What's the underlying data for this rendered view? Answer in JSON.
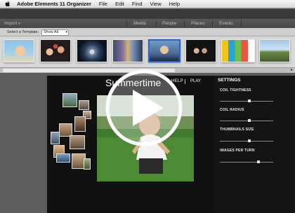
{
  "menubar": {
    "app_name": "Adobe Elements 11 Organizer",
    "items": [
      "File",
      "Edit",
      "Find",
      "View",
      "Help"
    ]
  },
  "toolbar": {
    "import_label": "Import",
    "import_arrow": "▾",
    "tabs": [
      "Media",
      "People",
      "Places",
      "Events"
    ]
  },
  "template_bar": {
    "label": "Select a Template:",
    "selected": "Show All",
    "arrow": "▾"
  },
  "slideshow": {
    "title": "Summertime",
    "help_label": "HELP",
    "play_label": "PLAY"
  },
  "settings": {
    "heading": "SETTINGS",
    "items": [
      {
        "label": "COIL TIGHTNESS",
        "level": 0.55
      },
      {
        "label": "COIL RADIUS",
        "level": 0.55
      },
      {
        "label": "THUMBNAILS SIZE",
        "level": 0.55
      },
      {
        "label": "IMAGES PER TURN",
        "level": 0.72
      }
    ]
  },
  "colors": {
    "stage_bg": "#111111",
    "panel_bg": "#141414",
    "toolbar_bg": "#4d4d4d",
    "play_overlay": "#ffffff"
  },
  "icons": [
    "apple-icon",
    "play-overlay-icon",
    "scroll-left-arrow-icon",
    "scroll-right-arrow-icon"
  ]
}
